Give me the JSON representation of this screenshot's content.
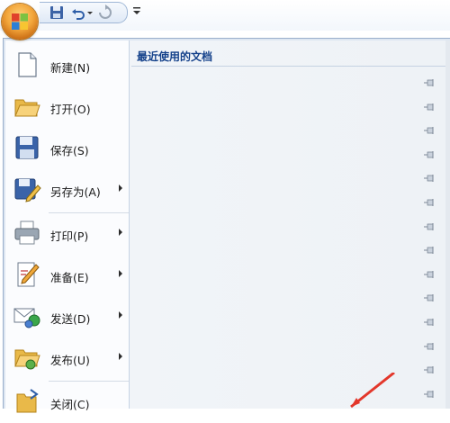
{
  "menu": {
    "items": [
      {
        "label": "新建(N)",
        "icon": "new-document-icon",
        "submenu": false
      },
      {
        "label": "打开(O)",
        "icon": "open-folder-icon",
        "submenu": false
      },
      {
        "label": "保存(S)",
        "icon": "save-floppy-icon",
        "submenu": false
      },
      {
        "label": "另存为(A)",
        "icon": "save-as-icon",
        "submenu": true
      },
      {
        "label": "打印(P)",
        "icon": "printer-icon",
        "submenu": true
      },
      {
        "label": "准备(E)",
        "icon": "prepare-document-icon",
        "submenu": true
      },
      {
        "label": "发送(D)",
        "icon": "send-mail-icon",
        "submenu": true
      },
      {
        "label": "发布(U)",
        "icon": "publish-folder-icon",
        "submenu": true
      },
      {
        "label": "关闭(C)",
        "icon": "close-document-icon",
        "submenu": false
      }
    ]
  },
  "recent": {
    "title": "最近使用的文档",
    "pin_icon": "pin-icon",
    "pin_count": 14
  },
  "colors": {
    "accent": "#15428b",
    "menu_bg": "#dde6f1",
    "orb": "#f2a53a",
    "pointer": "#e3372b"
  }
}
